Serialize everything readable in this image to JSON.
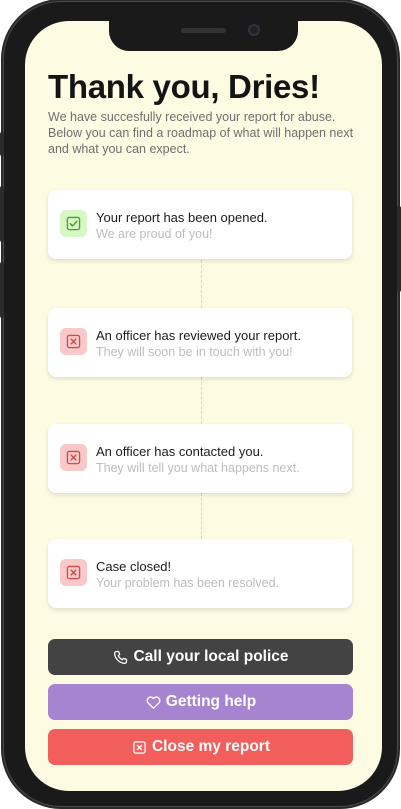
{
  "header": {
    "title": "Thank you, Dries!",
    "intro": "We have succesfully received your report for abuse. Below you can find a roadmap of what will happen next and what you can expect."
  },
  "steps": [
    {
      "title": "Your report has been opened.",
      "subtitle": "We are proud of you!",
      "status": "done",
      "icon": "check-icon"
    },
    {
      "title": "An officer has reviewed your report.",
      "subtitle": "They will soon be in touch with you!",
      "status": "pending",
      "icon": "close-icon"
    },
    {
      "title": "An officer has contacted you.",
      "subtitle": "They will tell you what happens next.",
      "status": "pending",
      "icon": "close-icon"
    },
    {
      "title": "Case closed!",
      "subtitle": "Your problem has been resolved.",
      "status": "pending",
      "icon": "close-icon"
    }
  ],
  "actions": {
    "call_label": "Call your local police",
    "help_label": "Getting help",
    "close_label": "Close my report"
  },
  "colors": {
    "background": "#fdfbe2",
    "done": "#d6f9c4",
    "pending": "#f9c9c9",
    "call": "#434343",
    "help": "#a784d0",
    "close": "#f25e5b"
  }
}
